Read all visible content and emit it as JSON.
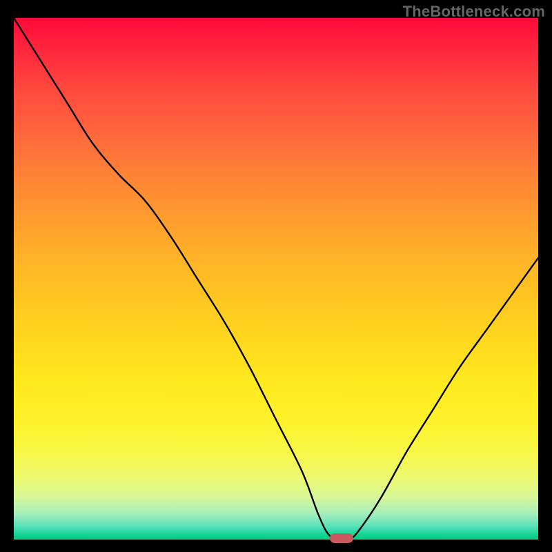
{
  "watermark": "TheBottleneck.com",
  "marker": {
    "color": "#c85a5f",
    "x_frac": 0.625,
    "y_frac": 0.0
  },
  "chart_data": {
    "type": "line",
    "title": "",
    "xlabel": "",
    "ylabel": "",
    "xlim": [
      0,
      100
    ],
    "ylim": [
      0,
      100
    ],
    "x": [
      0,
      5,
      10,
      15,
      20,
      25,
      30,
      35,
      40,
      45,
      50,
      55,
      58,
      60,
      62,
      64,
      66,
      70,
      75,
      80,
      85,
      90,
      95,
      100
    ],
    "values": [
      100,
      92,
      84,
      76,
      70,
      65,
      58,
      50,
      42,
      33,
      23,
      13,
      5,
      1,
      0,
      0,
      2,
      8,
      17,
      25,
      33,
      40,
      47,
      54
    ],
    "marker_x": 62.5,
    "marker_y": 0,
    "gradient_stops": [
      {
        "pos": 0.0,
        "color": "#ff0a3a"
      },
      {
        "pos": 0.3,
        "color": "#ff8236"
      },
      {
        "pos": 0.62,
        "color": "#ffd91e"
      },
      {
        "pos": 0.83,
        "color": "#edf96e"
      },
      {
        "pos": 0.95,
        "color": "#a6eebc"
      },
      {
        "pos": 1.0,
        "color": "#00c97b"
      }
    ]
  }
}
